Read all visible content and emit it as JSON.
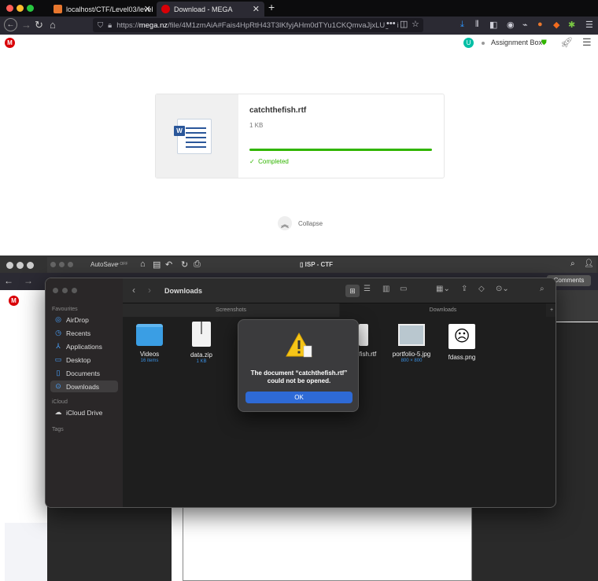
{
  "browser": {
    "tabs": [
      {
        "label": "localhost/CTF/Level03/level03.p"
      },
      {
        "label": "Download - MEGA"
      }
    ],
    "url_prefix": "https://",
    "url_domain": "mega.nz",
    "url_path": "/file/4M1zmAiA#Fais4HpRtH43T3lKfyjAHm0dTYu1CKQmvaJjxLUg1ki"
  },
  "mega": {
    "account_initial": "U",
    "account_name": "Assignment Box",
    "file_name": "catchthefish.rtf",
    "file_size": "1 KB",
    "progress": 1.0,
    "status": "Completed",
    "collapse_label": "Collapse"
  },
  "word": {
    "autosave_label": "AutoSave",
    "autosave_state": "OFF",
    "doc_title": "ISP - CTF",
    "comments_label": "Comments"
  },
  "finder": {
    "location": "Downloads",
    "tabs": [
      "Screenshots",
      "Downloads"
    ],
    "sidebar": {
      "favourites_heading": "Favourites",
      "favourites": [
        {
          "label": "AirDrop",
          "icon": "airdrop-icon"
        },
        {
          "label": "Recents",
          "icon": "clock-icon"
        },
        {
          "label": "Applications",
          "icon": "applications-icon"
        },
        {
          "label": "Desktop",
          "icon": "desktop-icon"
        },
        {
          "label": "Documents",
          "icon": "document-icon"
        },
        {
          "label": "Downloads",
          "icon": "download-icon"
        }
      ],
      "icloud_heading": "iCloud",
      "icloud_items": [
        {
          "label": "iCloud Drive",
          "icon": "cloud-icon"
        }
      ],
      "tags_heading": "Tags"
    },
    "items": [
      {
        "name": "Videos",
        "sub": "16 items"
      },
      {
        "name": "data.zip",
        "sub": "1 KB"
      },
      {
        "name": "efish.rtf",
        "sub": ""
      },
      {
        "name": "portfolio-5.jpg",
        "sub": "800 × 800"
      },
      {
        "name": "fdass.png",
        "sub": ""
      }
    ]
  },
  "alert": {
    "message_line1": "The document “catchthefish.rtf”",
    "message_line2": "could not be opened.",
    "ok_label": "OK"
  },
  "colors": {
    "mega_red": "#d90007",
    "mega_green": "#31b500",
    "macos_blue": "#2e6ad6"
  }
}
